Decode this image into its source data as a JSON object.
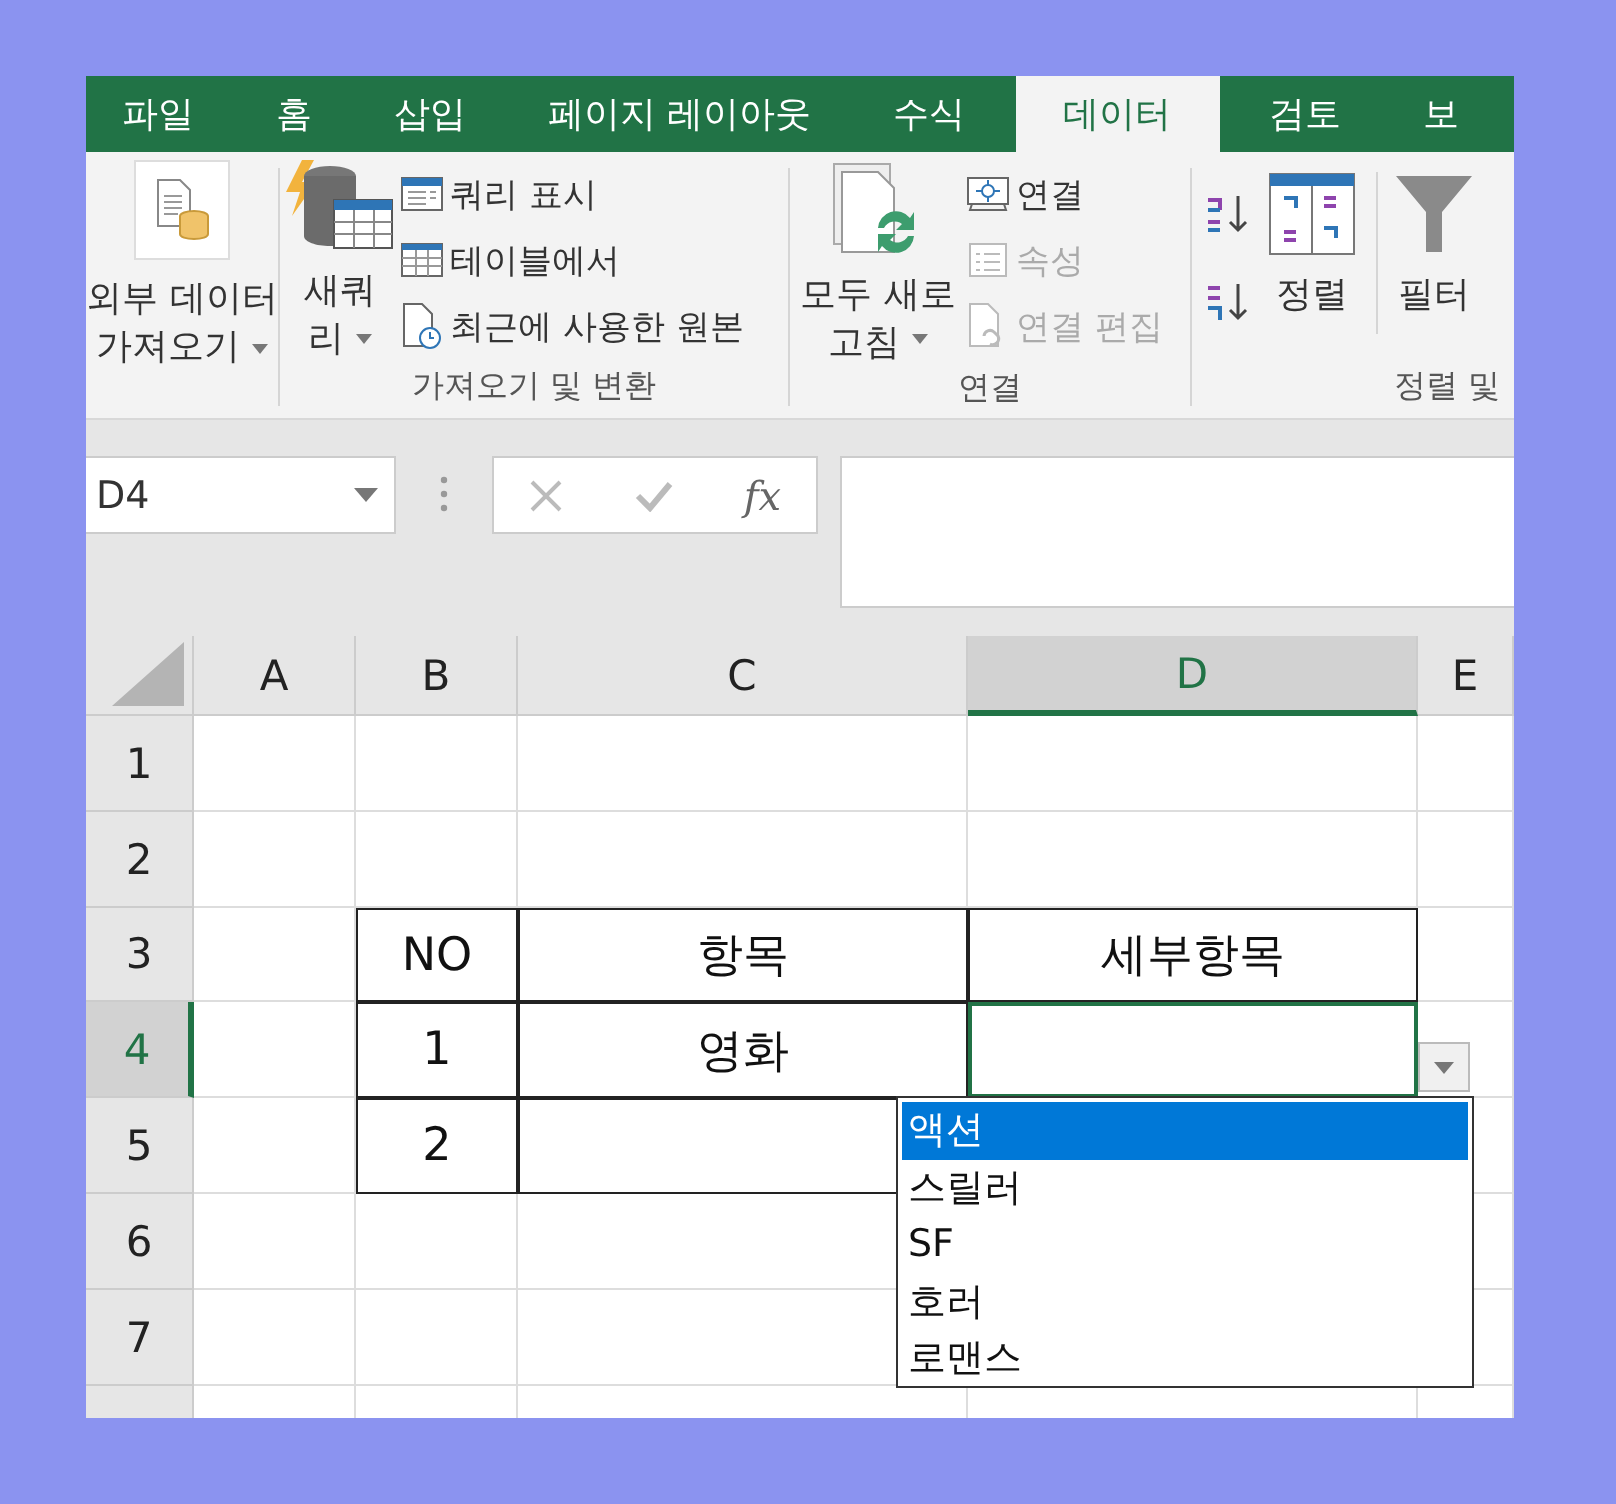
{
  "ribbon_tabs": [
    {
      "label": "파일",
      "selected": false
    },
    {
      "label": "홈",
      "selected": false
    },
    {
      "label": "삽입",
      "selected": false
    },
    {
      "label": "페이지 레이아웃",
      "selected": false
    },
    {
      "label": "수식",
      "selected": false
    },
    {
      "label": "데이터",
      "selected": true
    },
    {
      "label": "검토",
      "selected": false
    },
    {
      "label": "보",
      "selected": false
    }
  ],
  "ribbon": {
    "external_data": {
      "lines": [
        "외부 데이터",
        "가져오기"
      ]
    },
    "get_transform": {
      "label": "가져오기 및 변환",
      "new_query": {
        "lines": [
          "새쿼",
          "리"
        ]
      },
      "commands": [
        {
          "label": "쿼리 표시",
          "disabled": false
        },
        {
          "label": "테이블에서",
          "disabled": false
        },
        {
          "label": "최근에 사용한 원본",
          "disabled": false
        }
      ]
    },
    "connections": {
      "label": "연결",
      "refresh_all": {
        "lines": [
          "모두 새로",
          "고침"
        ]
      },
      "commands": [
        {
          "label": "연결",
          "disabled": false
        },
        {
          "label": "속성",
          "disabled": true
        },
        {
          "label": "연결 편집",
          "disabled": true
        }
      ]
    },
    "sort_filter": {
      "label": "정렬 및",
      "sort": "정렬",
      "filter": "필터"
    }
  },
  "formula_bar": {
    "name_box": "D4",
    "function_label": "fx"
  },
  "columns": [
    {
      "label": "A",
      "selected": false
    },
    {
      "label": "B",
      "selected": false
    },
    {
      "label": "C",
      "selected": false
    },
    {
      "label": "D",
      "selected": true
    },
    {
      "label": "E",
      "selected": false
    }
  ],
  "rows": [
    {
      "label": "1",
      "selected": false
    },
    {
      "label": "2",
      "selected": false
    },
    {
      "label": "3",
      "selected": false
    },
    {
      "label": "4",
      "selected": true
    },
    {
      "label": "5",
      "selected": false
    },
    {
      "label": "6",
      "selected": false
    },
    {
      "label": "7",
      "selected": false
    }
  ],
  "table": {
    "headers": [
      "NO",
      "항목",
      "세부항목"
    ],
    "rows": [
      {
        "no": "1",
        "item": "영화",
        "detail_selected": true
      },
      {
        "no": "2"
      }
    ]
  },
  "dropdown": {
    "options": [
      {
        "label": "액션",
        "selected": true
      },
      {
        "label": "스릴러",
        "selected": false
      },
      {
        "label": "SF",
        "selected": false
      },
      {
        "label": "호러",
        "selected": false
      },
      {
        "label": "로맨스",
        "selected": false
      }
    ]
  }
}
